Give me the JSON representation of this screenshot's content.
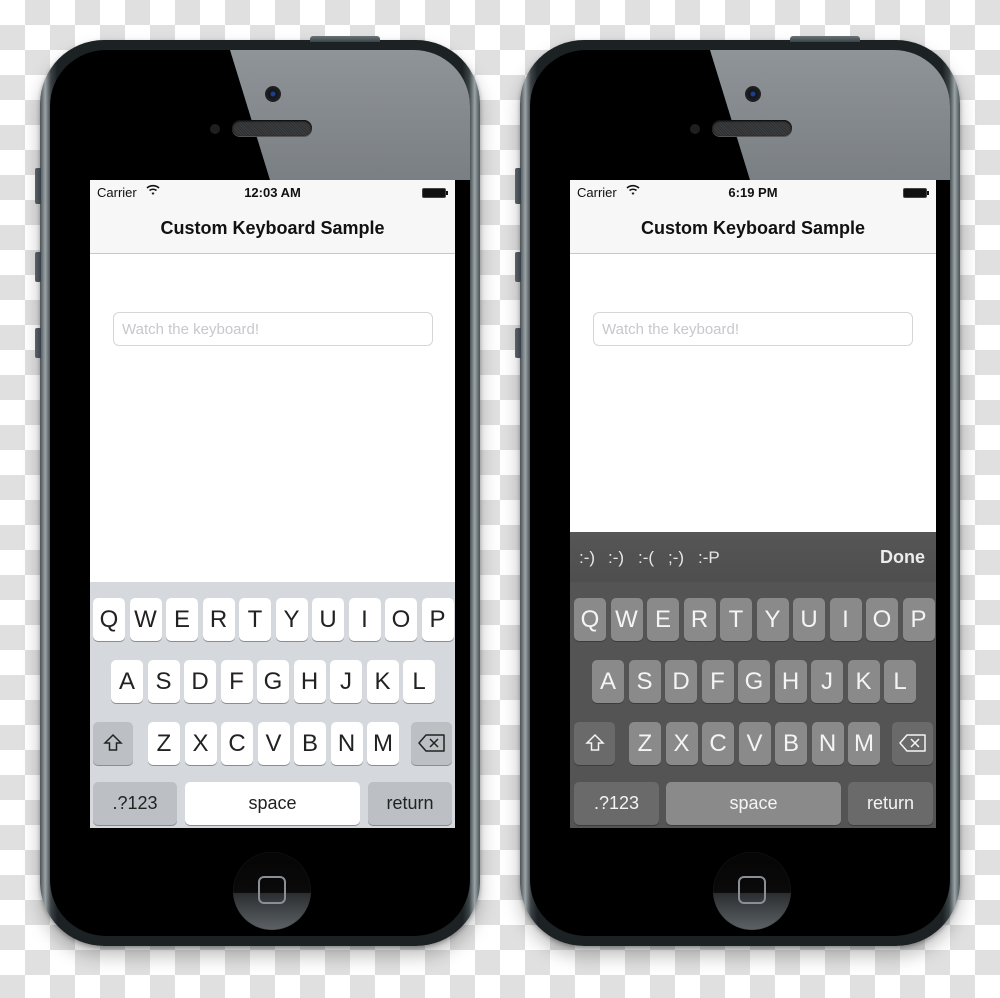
{
  "phones": [
    {
      "theme": "light",
      "status_bar": {
        "carrier": "Carrier",
        "time": "12:03 AM"
      },
      "nav_title": "Custom Keyboard Sample",
      "text_field": {
        "placeholder": "Watch the keyboard!",
        "value": ""
      },
      "keyboard": {
        "row1": [
          "Q",
          "W",
          "E",
          "R",
          "T",
          "Y",
          "U",
          "I",
          "O",
          "P"
        ],
        "row2": [
          "A",
          "S",
          "D",
          "F",
          "G",
          "H",
          "J",
          "K",
          "L"
        ],
        "row3": [
          "Z",
          "X",
          "C",
          "V",
          "B",
          "N",
          "M"
        ],
        "numbers_label": ".?123",
        "space_label": "space",
        "return_label": "return",
        "shift_icon": "shift-icon",
        "delete_icon": "delete-icon"
      }
    },
    {
      "theme": "dark",
      "status_bar": {
        "carrier": "Carrier",
        "time": "6:19 PM"
      },
      "nav_title": "Custom Keyboard Sample",
      "text_field": {
        "placeholder": "Watch the keyboard!",
        "value": ""
      },
      "accessory_bar": {
        "emoticons": [
          ":-)",
          ":-)",
          ":-(",
          ";-)",
          ":-P"
        ],
        "done_label": "Done"
      },
      "keyboard": {
        "row1": [
          "Q",
          "W",
          "E",
          "R",
          "T",
          "Y",
          "U",
          "I",
          "O",
          "P"
        ],
        "row2": [
          "A",
          "S",
          "D",
          "F",
          "G",
          "H",
          "J",
          "K",
          "L"
        ],
        "row3": [
          "Z",
          "X",
          "C",
          "V",
          "B",
          "N",
          "M"
        ],
        "numbers_label": ".?123",
        "space_label": "space",
        "return_label": "return",
        "shift_icon": "shift-icon",
        "delete_icon": "delete-icon"
      }
    }
  ],
  "colors": {
    "light_keyboard_bg": "#d5d8dc",
    "dark_keyboard_bg": "#545454",
    "dark_key": "#8a8a8a",
    "nav_bar_bg": "#f7f7f7",
    "placeholder": "#c7c7cd"
  }
}
